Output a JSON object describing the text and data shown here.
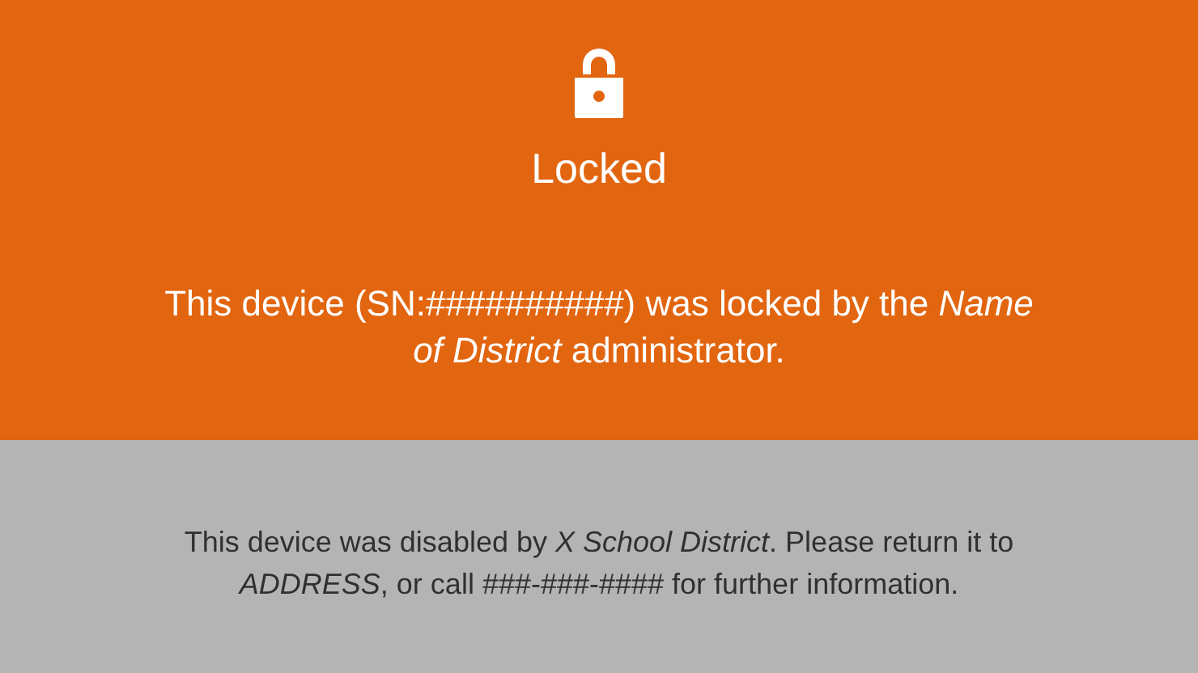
{
  "lock_panel": {
    "title": "Locked",
    "message": "This device (SN:##########) was locked by the *Name of District* administrator."
  },
  "info_panel": {
    "message": "This device was disabled by *X School District*. Please return it to *ADDRESS*, or call ###-###-#### for further information."
  }
}
